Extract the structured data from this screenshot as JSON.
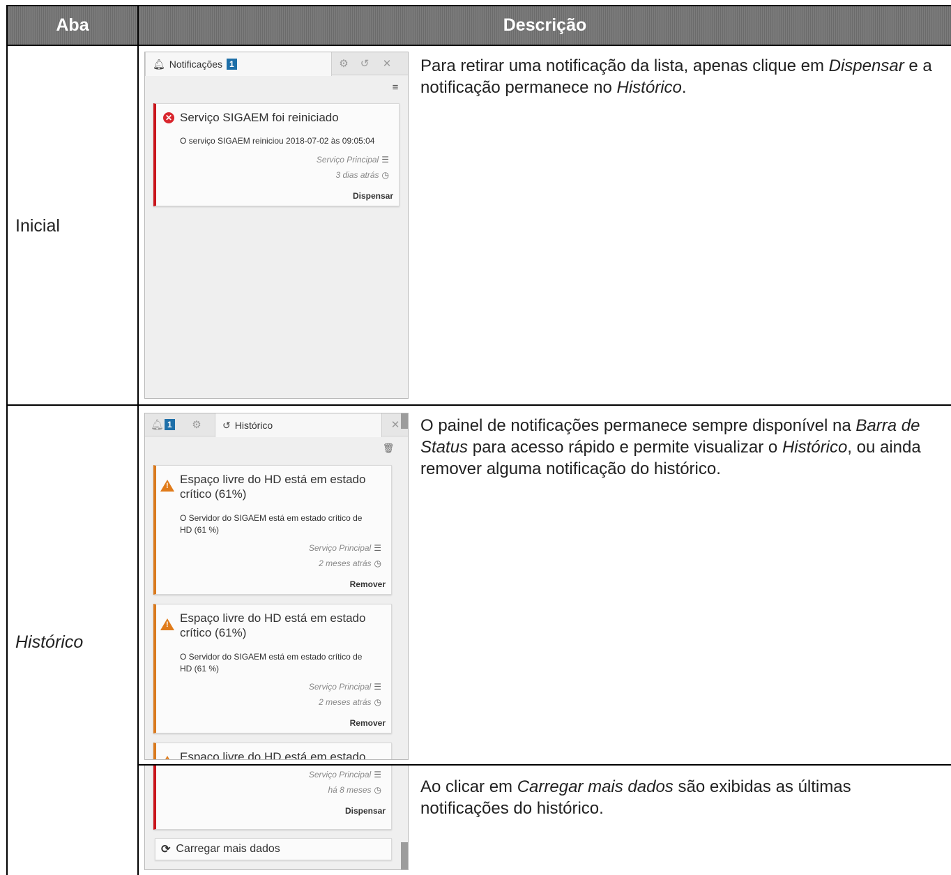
{
  "table": {
    "col_headers": {
      "aba": "Aba",
      "descricao": "Descrição"
    },
    "rows": [
      {
        "label": "Inicial",
        "description": {
          "part1": "Para retirar uma notificação da lista, apenas clique em ",
          "em1": "Dispensar",
          "part2": " e a notificação permanece no ",
          "em2": "Histórico",
          "part3": "."
        }
      },
      {
        "label": "Histórico",
        "description": {
          "part1": "O painel de notificações permanece sempre disponível na ",
          "em1": "Barra de Status",
          "part2": " para acesso rápido e permite visualizar o ",
          "em2": "Histórico",
          "part3": ", ou ainda remover alguma notificação do histórico."
        }
      },
      {
        "description": {
          "part1": "Ao clicar em ",
          "em1": "Carregar mais dados",
          "part2": " são exibidas as últimas notificações do histórico."
        }
      }
    ]
  },
  "panel_notifications": {
    "tab_label": "Notificações",
    "badge": "1",
    "icons": [
      "bell-icon",
      "gear-icon",
      "history-icon",
      "close-icon",
      "list-icon"
    ],
    "card": {
      "title": "Serviço SIGAEM foi reiniciado",
      "message": "O serviço SIGAEM reiniciou 2018-07-02 às 09:05:04",
      "source": "Serviço Principal",
      "time": "3 dias atrás",
      "action": "Dispensar"
    }
  },
  "panel_history": {
    "badge": "1",
    "tab_label": "Histórico",
    "cards": [
      {
        "title_line1": "Espaço livre do HD está em estado",
        "title_line2": "crítico (61%)",
        "message_line1": "O Servidor do SIGAEM está em estado crítico de",
        "message_line2": "HD (61 %)",
        "source": "Serviço Principal",
        "time": "2 meses atrás",
        "action": "Remover"
      },
      {
        "title_line1": "Espaço livre do HD está em estado",
        "title_line2": "crítico (61%)",
        "message_line1": "O Servidor do SIGAEM está em estado crítico de",
        "message_line2": "HD (61 %)",
        "source": "Serviço Principal",
        "time": "2 meses atrás",
        "action": "Remover"
      },
      {
        "title_line1": "Espaço livre do HD está em estado"
      }
    ]
  },
  "panel_load_more": {
    "source": "Serviço Principal",
    "time": "há 8 meses",
    "action": "Dispensar",
    "load_more_label": "Carregar mais dados"
  },
  "colors": {
    "header_bg": "#737373",
    "error_red": "#c9141b",
    "warning_orange": "#d97a1e",
    "badge_blue": "#1e6fa8"
  }
}
